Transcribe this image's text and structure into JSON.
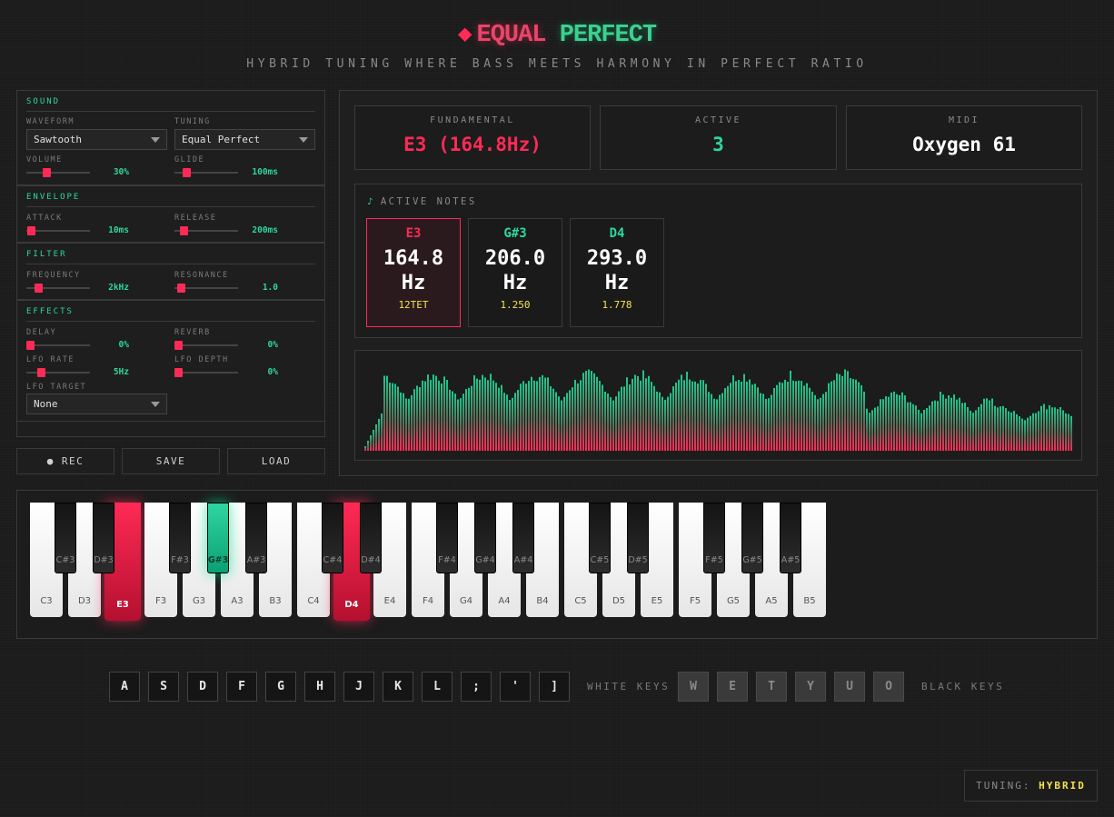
{
  "header": {
    "word1": "EQUAL",
    "word2": "PERFECT",
    "subtitle": "HYBRID TUNING WHERE BASS MEETS HARMONY IN PERFECT RATIO"
  },
  "controls": {
    "sound": {
      "title": "SOUND",
      "waveform_label": "WAVEFORM",
      "waveform_value": "Sawtooth",
      "tuning_label": "TUNING",
      "tuning_value": "Equal Perfect",
      "volume_label": "VOLUME",
      "volume_value": "30%",
      "volume_level": 0.3,
      "glide_label": "GLIDE",
      "glide_value": "100ms",
      "glide_level": 0.15
    },
    "envelope": {
      "title": "ENVELOPE",
      "attack_label": "ATTACK",
      "attack_value": "10ms",
      "attack_level": 0.02,
      "release_label": "RELEASE",
      "release_value": "200ms",
      "release_level": 0.1
    },
    "filter": {
      "title": "FILTER",
      "frequency_label": "FREQUENCY",
      "frequency_value": "2kHz",
      "frequency_level": 0.15,
      "resonance_label": "RESONANCE",
      "resonance_value": "1.0",
      "resonance_level": 0.05
    },
    "effects": {
      "title": "EFFECTS",
      "delay_label": "DELAY",
      "delay_value": "0%",
      "delay_level": 0,
      "reverb_label": "REVERB",
      "reverb_value": "0%",
      "reverb_level": 0,
      "lfo_rate_label": "LFO RATE",
      "lfo_rate_value": "5Hz",
      "lfo_rate_level": 0.2,
      "lfo_depth_label": "LFO DEPTH",
      "lfo_depth_value": "0%",
      "lfo_depth_level": 0,
      "lfo_target_label": "LFO TARGET",
      "lfo_target_value": "None"
    },
    "buttons": {
      "rec": "● REC",
      "save": "SAVE",
      "load": "LOAD"
    }
  },
  "stats": {
    "fundamental_label": "FUNDAMENTAL",
    "fundamental_value": "E3 (164.8Hz)",
    "active_label": "ACTIVE",
    "active_value": "3",
    "midi_label": "MIDI",
    "midi_value": "Oxygen 61"
  },
  "active_notes": {
    "icon": "♪",
    "title": "ACTIVE NOTES",
    "notes": [
      {
        "name": "E3",
        "freq": "164.8",
        "unit": "Hz",
        "ratio": "12TET",
        "color": "#ff2a55"
      },
      {
        "name": "G#3",
        "freq": "206.0",
        "unit": "Hz",
        "ratio": "1.250",
        "color": "#2ed6a0"
      },
      {
        "name": "D4",
        "freq": "293.0",
        "unit": "Hz",
        "ratio": "1.778",
        "color": "#2ed6a0"
      }
    ]
  },
  "keyboard": {
    "white_keys": [
      "C3",
      "D3",
      "E3",
      "F3",
      "G3",
      "A3",
      "B3",
      "C4",
      "D4",
      "E4",
      "F4",
      "G4",
      "A4",
      "B4",
      "C5",
      "D5",
      "E5",
      "F5",
      "G5",
      "A5",
      "B5"
    ],
    "black_keys": [
      "C#3",
      "D#3",
      "F#3",
      "G#3",
      "A#3",
      "C#4",
      "D#4",
      "F#4",
      "G#4",
      "A#4",
      "C#5",
      "D#5",
      "F#5",
      "G#5",
      "A#5"
    ],
    "pressed_white": [
      "E3",
      "D4"
    ],
    "pressed_black": [
      "G#3"
    ]
  },
  "shortcuts": {
    "white": [
      "A",
      "S",
      "D",
      "F",
      "G",
      "H",
      "J",
      "K",
      "L",
      ";",
      "'",
      "]"
    ],
    "white_caption": "WHITE KEYS",
    "black": [
      "W",
      "E",
      "T",
      "Y",
      "U",
      "O"
    ],
    "black_caption": "BLACK KEYS"
  },
  "tuning_badge": {
    "label": "TUNING:",
    "value": "HYBRID"
  },
  "colors": {
    "accent_red": "#ff2a55",
    "accent_green": "#2ed6a0",
    "highlight_yellow": "#f7e34a"
  }
}
